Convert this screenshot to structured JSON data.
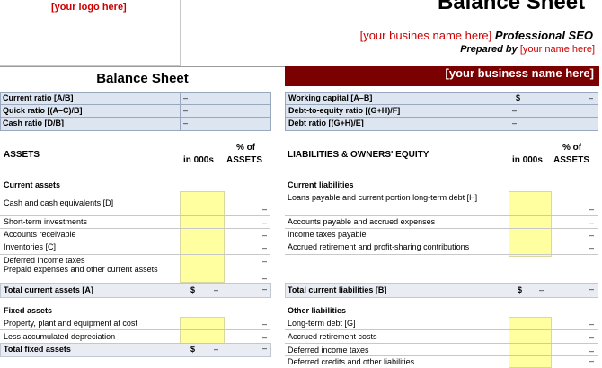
{
  "header": {
    "logo": "[your logo here]",
    "title": "Balance Sheet",
    "business_name_red": "[your busines name here]",
    "business_suffix": "Professional SEO",
    "prepared_by_label": "Prepared by",
    "prepared_by_value": "[your name here]"
  },
  "sheet": {
    "left_title": "Balance Sheet",
    "band_text": "[your business name here]"
  },
  "ratios_left": [
    {
      "label": "Current ratio  [A/B]",
      "value": "–"
    },
    {
      "label": "Quick ratio  [(A–C)/B]",
      "value": "–"
    },
    {
      "label": "Cash ratio  [D/B]",
      "value": "–"
    }
  ],
  "ratios_right": [
    {
      "label": "Working capital  [A–B]",
      "currency": "$",
      "value": "–"
    },
    {
      "label": "Debt-to-equity ratio  [(G+H)/F]",
      "currency": "",
      "value": "–"
    },
    {
      "label": "Debt ratio  [(G+H)/E]",
      "currency": "",
      "value": "–"
    }
  ],
  "columns": {
    "left_section": "ASSETS",
    "right_section": "LIABILITIES & OWNERS' EQUITY",
    "in000s": "in 000s",
    "pct_line1": "% of",
    "pct_assets": "ASSETS"
  },
  "current_assets": {
    "heading": "Current assets",
    "rows": [
      {
        "label": "Cash and cash equivalents  [D]",
        "pct": "–"
      },
      {
        "label": "Short-term investments",
        "pct": "–"
      },
      {
        "label": "Accounts receivable",
        "pct": "–"
      },
      {
        "label": "Inventories  [C]",
        "pct": "–"
      },
      {
        "label": "Deferred income taxes",
        "pct": "–"
      },
      {
        "label": "Prepaid expenses and other current assets",
        "pct": "–"
      }
    ],
    "total_label": "Total current assets  [A]",
    "total_currency": "$",
    "total_value": "–",
    "total_pct": "–"
  },
  "current_liabilities": {
    "heading": "Current liabilities",
    "rows": [
      {
        "label": "Loans payable and current portion long-term debt [H]",
        "pct": "–"
      },
      {
        "label": "Accounts payable and accrued expenses",
        "pct": "–"
      },
      {
        "label": "Income taxes payable",
        "pct": "–"
      },
      {
        "label": "Accrued retirement and profit-sharing contributions",
        "pct": "–"
      }
    ],
    "total_label": "Total current liabilities  [B]",
    "total_currency": "$",
    "total_value": "–",
    "total_pct": "–"
  },
  "fixed_assets": {
    "heading": "Fixed assets",
    "rows": [
      {
        "label": "Property, plant and equipment at cost",
        "pct": "–"
      },
      {
        "label": "Less accumulated depreciation",
        "pct": "–"
      }
    ],
    "total_label": "Total fixed assets",
    "total_currency": "$",
    "total_value": "–",
    "total_pct": "–"
  },
  "other_liabilities": {
    "heading": "Other liabilities",
    "rows": [
      {
        "label": "Long-term debt  [G]",
        "pct": "–"
      },
      {
        "label": "Accrued retirement costs",
        "pct": "–"
      },
      {
        "label": "Deferred income taxes",
        "pct": "–"
      },
      {
        "label": "Deferred credits and other liabilities",
        "pct": "–"
      }
    ]
  }
}
